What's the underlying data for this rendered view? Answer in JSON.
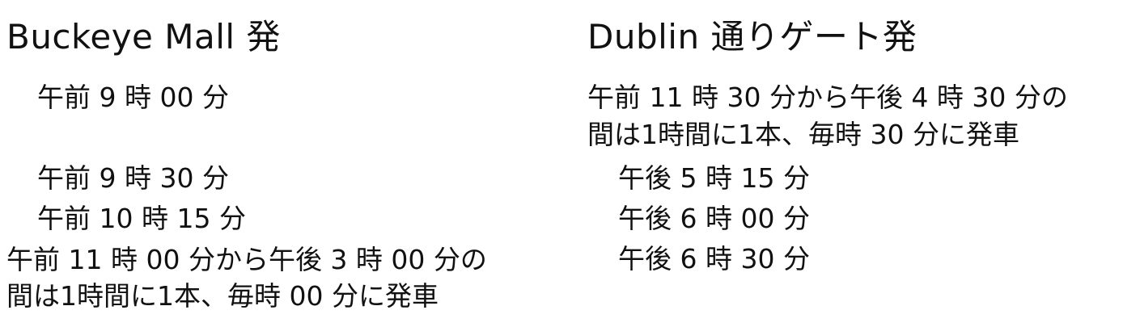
{
  "left": {
    "heading": "Buckeye Mall 発",
    "times": [
      "午前 9 時 00 分",
      "午前 9 時 30 分",
      "午前 10 時 15 分"
    ],
    "hourly": [
      "午前 11 時 00 分から午後 3 時 00 分の",
      "間は1時間に1本、毎時 00 分に発車"
    ]
  },
  "right": {
    "heading": "Dublin 通りゲート発",
    "hourly": [
      "午前 11 時 30 分から午後 4 時 30 分の",
      "間は1時間に1本、毎時 30 分に発車"
    ],
    "times": [
      "午後 5 時 15 分",
      "午後 6 時 00 分",
      "午後 6 時 30 分"
    ]
  }
}
